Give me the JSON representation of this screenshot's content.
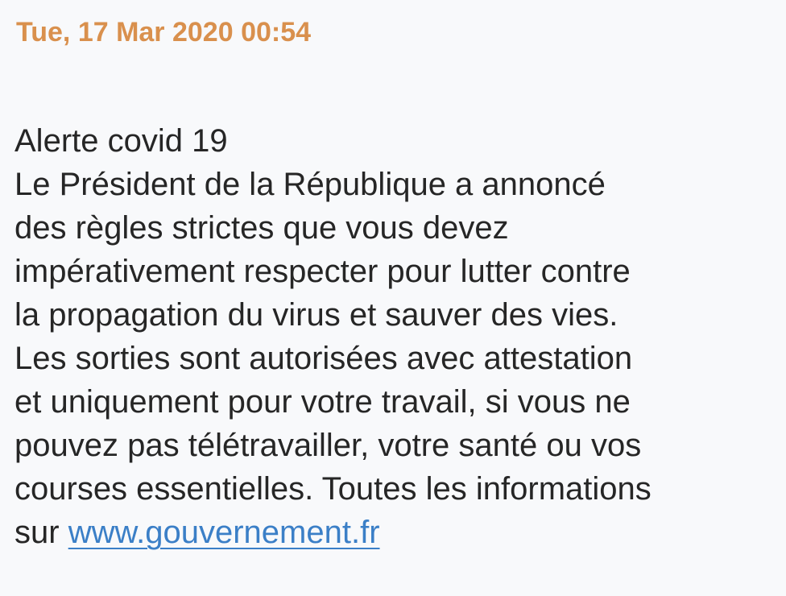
{
  "colors": {
    "timestamp": "#d9904d",
    "text": "#262626",
    "link": "#3b7fc7",
    "background": "#f8f9fb"
  },
  "message": {
    "timestamp": "Tue, 17 Mar 2020 00:54",
    "lines": [
      "Alerte covid 19",
      "Le Président de la République a annoncé",
      "des règles strictes que vous devez",
      "impérativement respecter pour lutter contre",
      "la propagation du virus et sauver des vies.",
      "Les sorties sont autorisées avec attestation",
      "et uniquement pour votre travail, si vous ne",
      "pouvez pas télétravailler, votre santé ou vos",
      "courses essentielles. Toutes les informations"
    ],
    "last_line_prefix": "sur ",
    "link_text": "www.gouvernement.fr"
  }
}
